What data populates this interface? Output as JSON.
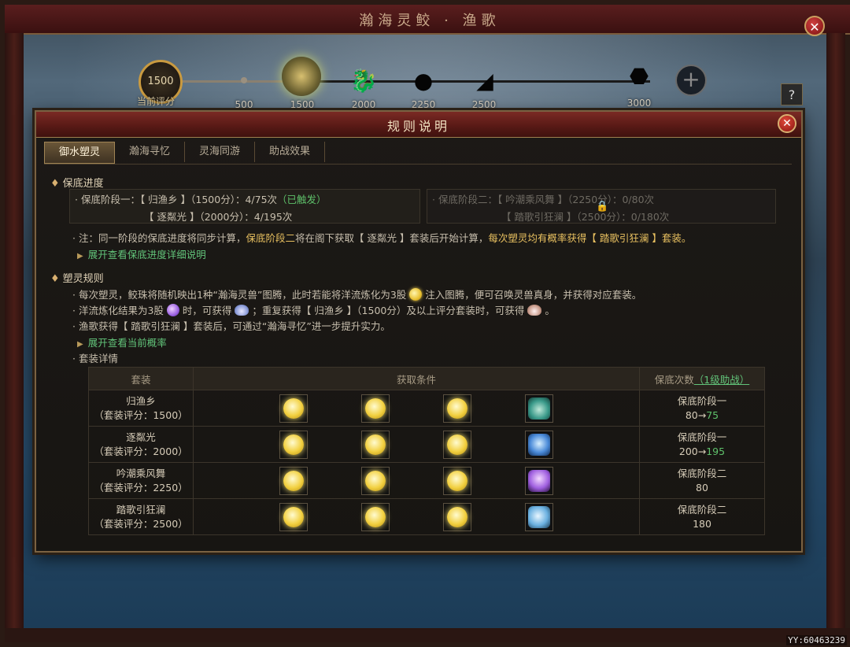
{
  "window": {
    "title": "瀚海灵鲛 · 渔歌",
    "close_label": "✕"
  },
  "track": {
    "current_score": "1500",
    "current_label": "当前评分",
    "milestones": [
      "500",
      "1500",
      "2000",
      "2250",
      "2500",
      "3000"
    ],
    "plus_label": "+",
    "side_button_label": "?"
  },
  "dialog": {
    "title": "规则说明",
    "close_label": "✕",
    "tabs": [
      "御水塑灵",
      "瀚海寻忆",
      "灵海同游",
      "助战效果"
    ],
    "active_tab": 0
  },
  "guarantee": {
    "heading": "保底进度",
    "stage1_prefix": "· 保底阶段一：【 归渔乡 】（1500分）：4/75次",
    "stage1_triggered": "（已触发）",
    "stage1_line2": "【 逐粼光 】（2000分）：4/195次",
    "stage2_line1": "· 保底阶段二：【 吟潮乘风舞 】（2250分）：0/80次",
    "stage2_line2": "【 踏歌引狂澜 】（2500分）：0/180次",
    "note_part1": "· 注：同一阶段的保底进度将同步计算，",
    "note_highlight1": "保底阶段二",
    "note_part2": "将在阁下获取【 逐粼光 】套装后开始计算，",
    "note_highlight2": "每次塑灵均有概率获得【 踏歌引狂澜 】套装。",
    "expand_link": "展开查看保底进度详细说明"
  },
  "rules": {
    "heading": "塑灵规则",
    "line1_a": "· 每次塑灵，鲛珠将随机映出1种“瀚海灵兽”图腾，此时若能将洋流炼化为3股",
    "line1_b": "注入图腾，便可召唤灵兽真身，并获得对应套装。",
    "line2_a": "· 洋流炼化结果为3股",
    "line2_b": "时，可获得",
    "line2_c": "；重复获得【 归渔乡 】（1500分）及以上评分套装时，可获得",
    "line2_d": "。",
    "line3": "· 渔歌获得【 踏歌引狂澜 】套装后，可通过“瀚海寻忆”进一步提升实力。",
    "expand_link": "展开查看当前概率",
    "suit_detail": "· 套装详情"
  },
  "suit_table": {
    "headers": [
      "套装",
      "获取条件",
      "保底次数",
      "（1级助战）"
    ],
    "rows": [
      {
        "name": "归渔乡",
        "score": "（套装评分：1500）",
        "stage": "保底阶段一",
        "count_from": "80→",
        "count_to": "75",
        "beast": "crab-icon"
      },
      {
        "name": "逐粼光",
        "score": "（套装评分：2000）",
        "stage": "保底阶段一",
        "count_from": "200→",
        "count_to": "195",
        "beast": "seahorse-icon"
      },
      {
        "name": "吟潮乘风舞",
        "score": "（套装评分：2250）",
        "stage": "保底阶段二",
        "count_from": "80",
        "count_to": "",
        "beast": "jellyfish-icon"
      },
      {
        "name": "踏歌引狂澜",
        "score": "（套装评分：2500）",
        "stage": "保底阶段二",
        "count_from": "180",
        "count_to": "",
        "beast": "dolphin-icon"
      }
    ]
  },
  "watermark": "YY:60463239",
  "colors": {
    "gold": "#e8c060",
    "green": "#5ec06a",
    "header_red": "#6a2420",
    "frame": "#7a6242"
  }
}
